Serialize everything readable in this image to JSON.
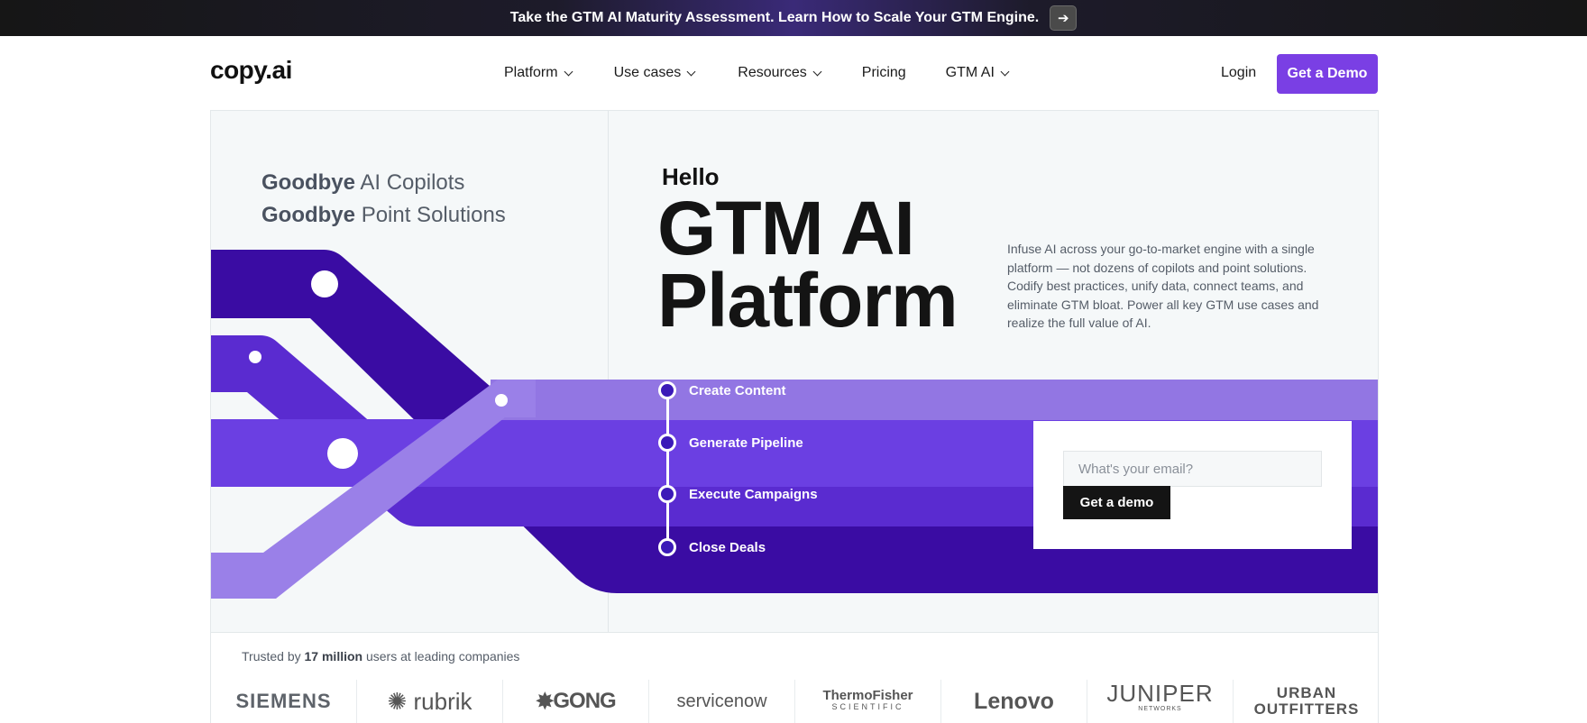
{
  "announcement": {
    "text": "Take the GTM AI Maturity Assessment. Learn How to Scale Your GTM Engine.",
    "arrow_icon": "arrow-right-icon"
  },
  "nav": {
    "logo": "copy.ai",
    "items": [
      {
        "label": "Platform",
        "dropdown": true
      },
      {
        "label": "Use cases",
        "dropdown": true
      },
      {
        "label": "Resources",
        "dropdown": true
      },
      {
        "label": "Pricing",
        "dropdown": false
      },
      {
        "label": "GTM AI",
        "dropdown": true
      }
    ],
    "login": "Login",
    "demo": "Get a Demo"
  },
  "hero": {
    "goodbye_1_bold": "Goodbye",
    "goodbye_1_rest": "AI Copilots",
    "goodbye_2_bold": "Goodbye",
    "goodbye_2_rest": "Point Solutions",
    "hello": "Hello",
    "title_line1": "GTM AI",
    "title_line2": "Platform",
    "description": "Infuse AI across your go-to-market engine with a single platform — not dozens of copilots and point solutions. Codify best practices, unify data, connect teams, and eliminate GTM bloat. Power all key GTM use cases and realize the full value of AI.",
    "steps": [
      "Create Content",
      "Generate Pipeline",
      "Execute Campaigns",
      "Close Deals"
    ],
    "email_placeholder": "What's your email?",
    "cta": "Get a demo"
  },
  "trust": {
    "prefix": "Trusted by",
    "count": "17 million",
    "suffix": "users at leading companies",
    "logos": [
      "SIEMENS",
      "rubrik",
      "GONG",
      "servicenow",
      "ThermoFisher",
      "SCIENTIFIC",
      "Lenovo",
      "JUNIPER",
      "NETWORKS",
      "URBAN",
      "OUTFITTERS"
    ]
  },
  "colors": {
    "accent": "#7a3fe4",
    "deep_purple": "#3a0ca3",
    "mid_purple": "#6c3ce0",
    "light_purple": "#9b7fe6"
  }
}
